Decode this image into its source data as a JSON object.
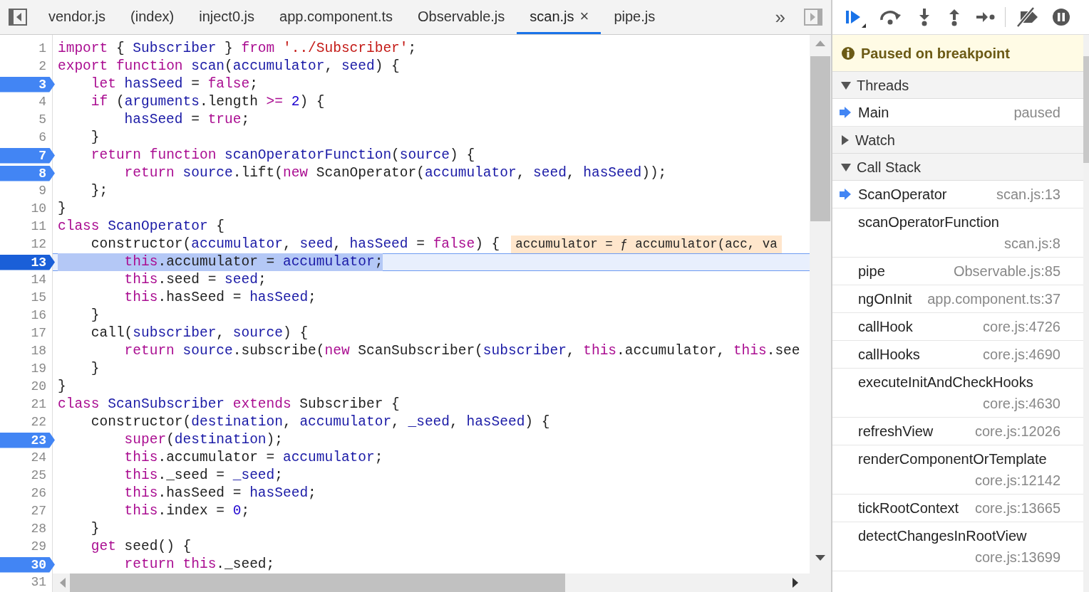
{
  "tabs": [
    {
      "label": "vendor.js",
      "selected": false
    },
    {
      "label": "(index)",
      "selected": false
    },
    {
      "label": "inject0.js",
      "selected": false
    },
    {
      "label": "app.component.ts",
      "selected": false
    },
    {
      "label": "Observable.js",
      "selected": false
    },
    {
      "label": "scan.js",
      "selected": true,
      "close": "×"
    },
    {
      "label": "pipe.js",
      "selected": false
    }
  ],
  "tabs_overflow": "»",
  "editor": {
    "lines": [
      {
        "number": "1",
        "breakpoint": false,
        "current": false,
        "tokens": [
          {
            "kind": "keyword",
            "text": "import"
          },
          {
            "kind": "plain",
            "text": " { "
          },
          {
            "kind": "variable",
            "text": "Subscriber"
          },
          {
            "kind": "plain",
            "text": " } "
          },
          {
            "kind": "keyword",
            "text": "from"
          },
          {
            "kind": "string",
            "text": " '../Subscriber'"
          },
          {
            "kind": "plain",
            "text": ";"
          }
        ]
      },
      {
        "number": "2",
        "breakpoint": false,
        "current": false,
        "tokens": [
          {
            "kind": "keyword",
            "text": "export"
          },
          {
            "kind": "keyword",
            "text": " function"
          },
          {
            "kind": "variable",
            "text": " scan"
          },
          {
            "kind": "plain",
            "text": "("
          },
          {
            "kind": "variable",
            "text": "accumulator"
          },
          {
            "kind": "plain",
            "text": ", "
          },
          {
            "kind": "variable",
            "text": "seed"
          },
          {
            "kind": "plain",
            "text": ") {"
          }
        ]
      },
      {
        "number": "3",
        "breakpoint": true,
        "current": false,
        "tokens": [
          {
            "kind": "keyword",
            "text": "    let"
          },
          {
            "kind": "variable",
            "text": " hasSeed"
          },
          {
            "kind": "plain",
            "text": " = "
          },
          {
            "kind": "keyword",
            "text": "false"
          },
          {
            "kind": "plain",
            "text": ";"
          }
        ]
      },
      {
        "number": "4",
        "breakpoint": false,
        "current": false,
        "tokens": [
          {
            "kind": "keyword",
            "text": "    if"
          },
          {
            "kind": "plain",
            "text": " ("
          },
          {
            "kind": "variable",
            "text": "arguments"
          },
          {
            "kind": "plain",
            "text": ".length "
          },
          {
            "kind": "keyword",
            "text": ">="
          },
          {
            "kind": "number",
            "text": " 2"
          },
          {
            "kind": "plain",
            "text": ") {"
          }
        ]
      },
      {
        "number": "5",
        "breakpoint": false,
        "current": false,
        "tokens": [
          {
            "kind": "variable",
            "text": "        hasSeed"
          },
          {
            "kind": "plain",
            "text": " = "
          },
          {
            "kind": "keyword",
            "text": "true"
          },
          {
            "kind": "plain",
            "text": ";"
          }
        ]
      },
      {
        "number": "6",
        "breakpoint": false,
        "current": false,
        "tokens": [
          {
            "kind": "plain",
            "text": "    }"
          }
        ]
      },
      {
        "number": "7",
        "breakpoint": true,
        "current": false,
        "tokens": [
          {
            "kind": "keyword",
            "text": "    return"
          },
          {
            "kind": "keyword",
            "text": " function"
          },
          {
            "kind": "variable",
            "text": " scanOperatorFunction"
          },
          {
            "kind": "plain",
            "text": "("
          },
          {
            "kind": "variable",
            "text": "source"
          },
          {
            "kind": "plain",
            "text": ") {"
          }
        ]
      },
      {
        "number": "8",
        "breakpoint": true,
        "current": false,
        "tokens": [
          {
            "kind": "keyword",
            "text": "        return"
          },
          {
            "kind": "variable",
            "text": " source"
          },
          {
            "kind": "plain",
            "text": ".lift("
          },
          {
            "kind": "keyword",
            "text": "new"
          },
          {
            "kind": "plain",
            "text": " ScanOperator("
          },
          {
            "kind": "variable",
            "text": "accumulator"
          },
          {
            "kind": "plain",
            "text": ", "
          },
          {
            "kind": "variable",
            "text": "seed"
          },
          {
            "kind": "plain",
            "text": ", "
          },
          {
            "kind": "variable",
            "text": "hasSeed"
          },
          {
            "kind": "plain",
            "text": "));"
          }
        ]
      },
      {
        "number": "9",
        "breakpoint": false,
        "current": false,
        "tokens": [
          {
            "kind": "plain",
            "text": "    };"
          }
        ]
      },
      {
        "number": "10",
        "breakpoint": false,
        "current": false,
        "tokens": [
          {
            "kind": "plain",
            "text": "}"
          }
        ]
      },
      {
        "number": "11",
        "breakpoint": false,
        "current": false,
        "tokens": [
          {
            "kind": "keyword",
            "text": "class"
          },
          {
            "kind": "variable",
            "text": " ScanOperator"
          },
          {
            "kind": "plain",
            "text": " {"
          }
        ]
      },
      {
        "number": "12",
        "breakpoint": false,
        "current": false,
        "tokens": [
          {
            "kind": "plain",
            "text": "    constructor("
          },
          {
            "kind": "variable",
            "text": "accumulator"
          },
          {
            "kind": "plain",
            "text": ", "
          },
          {
            "kind": "variable",
            "text": "seed"
          },
          {
            "kind": "plain",
            "text": ", "
          },
          {
            "kind": "variable",
            "text": "hasSeed"
          },
          {
            "kind": "plain",
            "text": " = "
          },
          {
            "kind": "keyword",
            "text": "false"
          },
          {
            "kind": "plain",
            "text": ") {"
          }
        ],
        "inline_value": "accumulator = ƒ accumulator(acc, va"
      },
      {
        "number": "13",
        "breakpoint": true,
        "current": true,
        "tokens": [
          {
            "kind": "keyword",
            "text": "        this"
          },
          {
            "kind": "plain",
            "text": ".accumulator = "
          },
          {
            "kind": "variable",
            "text": "accumulator"
          },
          {
            "kind": "plain",
            "text": ";"
          }
        ]
      },
      {
        "number": "14",
        "breakpoint": false,
        "current": false,
        "tokens": [
          {
            "kind": "keyword",
            "text": "        this"
          },
          {
            "kind": "plain",
            "text": ".seed = "
          },
          {
            "kind": "variable",
            "text": "seed"
          },
          {
            "kind": "plain",
            "text": ";"
          }
        ]
      },
      {
        "number": "15",
        "breakpoint": false,
        "current": false,
        "tokens": [
          {
            "kind": "keyword",
            "text": "        this"
          },
          {
            "kind": "plain",
            "text": ".hasSeed = "
          },
          {
            "kind": "variable",
            "text": "hasSeed"
          },
          {
            "kind": "plain",
            "text": ";"
          }
        ]
      },
      {
        "number": "16",
        "breakpoint": false,
        "current": false,
        "tokens": [
          {
            "kind": "plain",
            "text": "    }"
          }
        ]
      },
      {
        "number": "17",
        "breakpoint": false,
        "current": false,
        "tokens": [
          {
            "kind": "plain",
            "text": "    call("
          },
          {
            "kind": "variable",
            "text": "subscriber"
          },
          {
            "kind": "plain",
            "text": ", "
          },
          {
            "kind": "variable",
            "text": "source"
          },
          {
            "kind": "plain",
            "text": ") {"
          }
        ]
      },
      {
        "number": "18",
        "breakpoint": false,
        "current": false,
        "tokens": [
          {
            "kind": "keyword",
            "text": "        return"
          },
          {
            "kind": "variable",
            "text": " source"
          },
          {
            "kind": "plain",
            "text": ".subscribe("
          },
          {
            "kind": "keyword",
            "text": "new"
          },
          {
            "kind": "plain",
            "text": " ScanSubscriber("
          },
          {
            "kind": "variable",
            "text": "subscriber"
          },
          {
            "kind": "plain",
            "text": ", "
          },
          {
            "kind": "keyword",
            "text": "this"
          },
          {
            "kind": "plain",
            "text": ".accumulator, "
          },
          {
            "kind": "keyword",
            "text": "this"
          },
          {
            "kind": "plain",
            "text": ".see"
          }
        ]
      },
      {
        "number": "19",
        "breakpoint": false,
        "current": false,
        "tokens": [
          {
            "kind": "plain",
            "text": "    }"
          }
        ]
      },
      {
        "number": "20",
        "breakpoint": false,
        "current": false,
        "tokens": [
          {
            "kind": "plain",
            "text": "}"
          }
        ]
      },
      {
        "number": "21",
        "breakpoint": false,
        "current": false,
        "tokens": [
          {
            "kind": "keyword",
            "text": "class"
          },
          {
            "kind": "variable",
            "text": " ScanSubscriber"
          },
          {
            "kind": "keyword",
            "text": " extends"
          },
          {
            "kind": "plain",
            "text": " Subscriber {"
          }
        ]
      },
      {
        "number": "22",
        "breakpoint": false,
        "current": false,
        "tokens": [
          {
            "kind": "plain",
            "text": "    constructor("
          },
          {
            "kind": "variable",
            "text": "destination"
          },
          {
            "kind": "plain",
            "text": ", "
          },
          {
            "kind": "variable",
            "text": "accumulator"
          },
          {
            "kind": "plain",
            "text": ", "
          },
          {
            "kind": "variable",
            "text": "_seed"
          },
          {
            "kind": "plain",
            "text": ", "
          },
          {
            "kind": "variable",
            "text": "hasSeed"
          },
          {
            "kind": "plain",
            "text": ") {"
          }
        ]
      },
      {
        "number": "23",
        "breakpoint": true,
        "current": false,
        "tokens": [
          {
            "kind": "keyword",
            "text": "        super"
          },
          {
            "kind": "plain",
            "text": "("
          },
          {
            "kind": "variable",
            "text": "destination"
          },
          {
            "kind": "plain",
            "text": ");"
          }
        ]
      },
      {
        "number": "24",
        "breakpoint": false,
        "current": false,
        "tokens": [
          {
            "kind": "keyword",
            "text": "        this"
          },
          {
            "kind": "plain",
            "text": ".accumulator = "
          },
          {
            "kind": "variable",
            "text": "accumulator"
          },
          {
            "kind": "plain",
            "text": ";"
          }
        ]
      },
      {
        "number": "25",
        "breakpoint": false,
        "current": false,
        "tokens": [
          {
            "kind": "keyword",
            "text": "        this"
          },
          {
            "kind": "plain",
            "text": "._seed = "
          },
          {
            "kind": "variable",
            "text": "_seed"
          },
          {
            "kind": "plain",
            "text": ";"
          }
        ]
      },
      {
        "number": "26",
        "breakpoint": false,
        "current": false,
        "tokens": [
          {
            "kind": "keyword",
            "text": "        this"
          },
          {
            "kind": "plain",
            "text": ".hasSeed = "
          },
          {
            "kind": "variable",
            "text": "hasSeed"
          },
          {
            "kind": "plain",
            "text": ";"
          }
        ]
      },
      {
        "number": "27",
        "breakpoint": false,
        "current": false,
        "tokens": [
          {
            "kind": "keyword",
            "text": "        this"
          },
          {
            "kind": "plain",
            "text": ".index = "
          },
          {
            "kind": "number",
            "text": "0"
          },
          {
            "kind": "plain",
            "text": ";"
          }
        ]
      },
      {
        "number": "28",
        "breakpoint": false,
        "current": false,
        "tokens": [
          {
            "kind": "plain",
            "text": "    }"
          }
        ]
      },
      {
        "number": "29",
        "breakpoint": false,
        "current": false,
        "tokens": [
          {
            "kind": "keyword",
            "text": "    get"
          },
          {
            "kind": "plain",
            "text": " seed() {"
          }
        ]
      },
      {
        "number": "30",
        "breakpoint": true,
        "current": false,
        "tokens": [
          {
            "kind": "keyword",
            "text": "        return"
          },
          {
            "kind": "keyword",
            "text": " this"
          },
          {
            "kind": "plain",
            "text": "._seed;"
          }
        ]
      },
      {
        "number": "31",
        "breakpoint": false,
        "current": false
      }
    ]
  },
  "debugger": {
    "status": "Paused on breakpoint",
    "sections": [
      {
        "kind": "threads",
        "title": "Threads",
        "expanded": true,
        "threads": [
          {
            "name": "Main",
            "status": "paused",
            "selected": true
          }
        ]
      },
      {
        "kind": "watch",
        "title": "Watch",
        "expanded": false
      },
      {
        "kind": "callstack",
        "title": "Call Stack",
        "expanded": true,
        "frames": [
          {
            "name": "ScanOperator",
            "location": "scan.js:13",
            "selected": true
          },
          {
            "name": "scanOperatorFunction",
            "location": "scan.js:8",
            "selected": false
          },
          {
            "name": "pipe",
            "location": "Observable.js:85",
            "selected": false
          },
          {
            "name": "ngOnInit",
            "location": "app.component.ts:37",
            "selected": false
          },
          {
            "name": "callHook",
            "location": "core.js:4726",
            "selected": false
          },
          {
            "name": "callHooks",
            "location": "core.js:4690",
            "selected": false
          },
          {
            "name": "executeInitAndCheckHooks",
            "location": "core.js:4630",
            "selected": false
          },
          {
            "name": "refreshView",
            "location": "core.js:12026",
            "selected": false
          },
          {
            "name": "renderComponentOrTemplate",
            "location": "core.js:12142",
            "selected": false
          },
          {
            "name": "tickRootContext",
            "location": "core.js:13665",
            "selected": false
          },
          {
            "name": "detectChangesInRootView",
            "location": "core.js:13699",
            "selected": false
          }
        ]
      }
    ]
  }
}
